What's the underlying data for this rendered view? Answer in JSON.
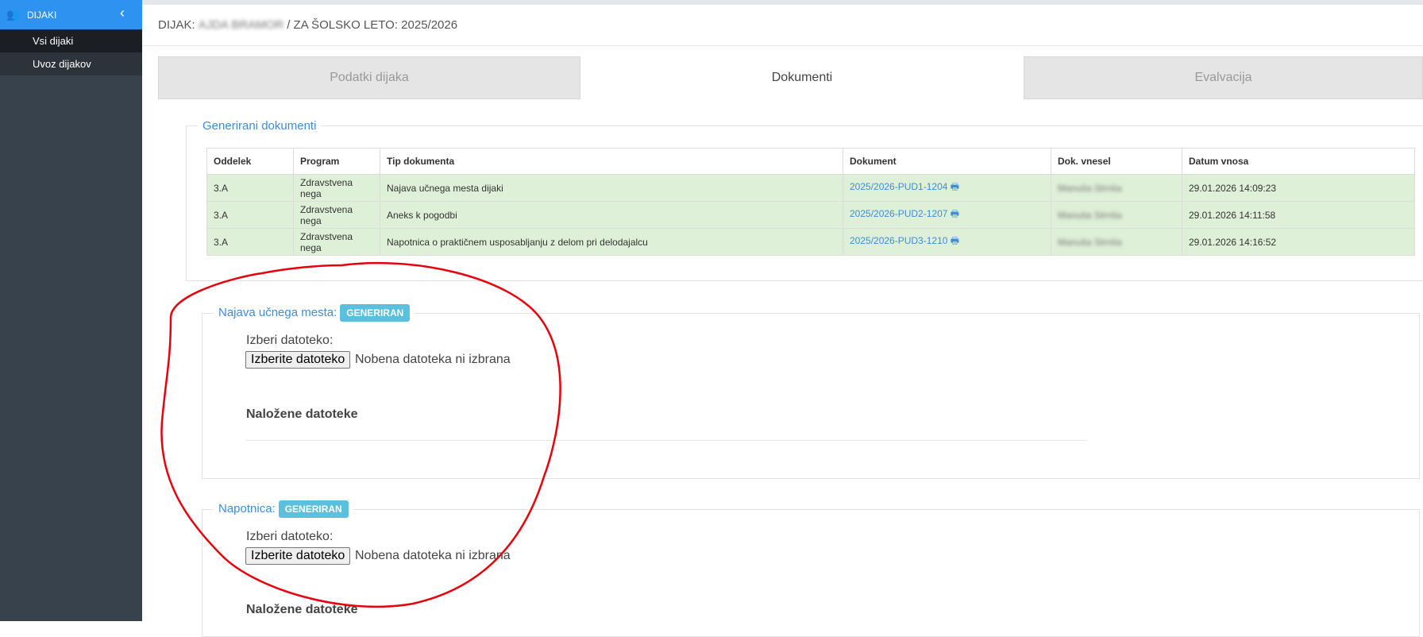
{
  "sidebar": {
    "section_label": "DIJAKI",
    "items": [
      {
        "label": "Vsi dijaki"
      },
      {
        "label": "Uvoz dijakov"
      }
    ]
  },
  "header": {
    "prefix": "DIJAK:",
    "student_name": "AJDA BRAMOR",
    "suffix": "/ ZA ŠOLSKO LETO: 2025/2026"
  },
  "tabs": [
    {
      "label": "Podatki dijaka",
      "active": false
    },
    {
      "label": "Dokumenti",
      "active": true
    },
    {
      "label": "Evalvacija",
      "active": false
    }
  ],
  "generated": {
    "legend": "Generirani dokumenti",
    "columns": [
      "Oddelek",
      "Program",
      "Tip dokumenta",
      "Dokument",
      "Dok. vnesel",
      "Datum vnosa"
    ],
    "rows": [
      {
        "oddelek": "3.A",
        "program": "Zdravstvena nega",
        "tip": "Najava učnega mesta dijaki",
        "dokument": "2025/2026-PUD1-1204",
        "vnesel": "Manuša Strnša",
        "datum": "29.01.2026 14:09:23"
      },
      {
        "oddelek": "3.A",
        "program": "Zdravstvena nega",
        "tip": "Aneks k pogodbi",
        "dokument": "2025/2026-PUD2-1207",
        "vnesel": "Manuša Strnša",
        "datum": "29.01.2026 14:11:58"
      },
      {
        "oddelek": "3.A",
        "program": "Zdravstvena nega",
        "tip": "Napotnica o praktičnem usposabljanju z delom pri delodajalcu",
        "dokument": "2025/2026-PUD3-1210",
        "vnesel": "Manuša Strnša",
        "datum": "29.01.2026 14:16:52"
      }
    ]
  },
  "najava": {
    "legend": "Najava učnega mesta:",
    "badge": "GENERIRAN",
    "choose_label": "Izberi datoteko:",
    "button": "Izberite datoteko",
    "no_file": "Nobena datoteka ni izbrana",
    "uploaded_heading": "Naložene datoteke"
  },
  "napotnica": {
    "legend": "Napotnica:",
    "badge": "GENERIRAN",
    "choose_label": "Izberi datoteko:",
    "button": "Izberite datoteko",
    "no_file": "Nobena datoteka ni izbrana",
    "uploaded_heading": "Naložene datoteke"
  },
  "colors": {
    "sidebar_bg": "#38424d",
    "sidebar_accent": "#2e93f0",
    "link": "#3c8dde",
    "row_bg": "#dff0d8",
    "badge": "#5bc0de",
    "annotation": "#e8000b"
  }
}
